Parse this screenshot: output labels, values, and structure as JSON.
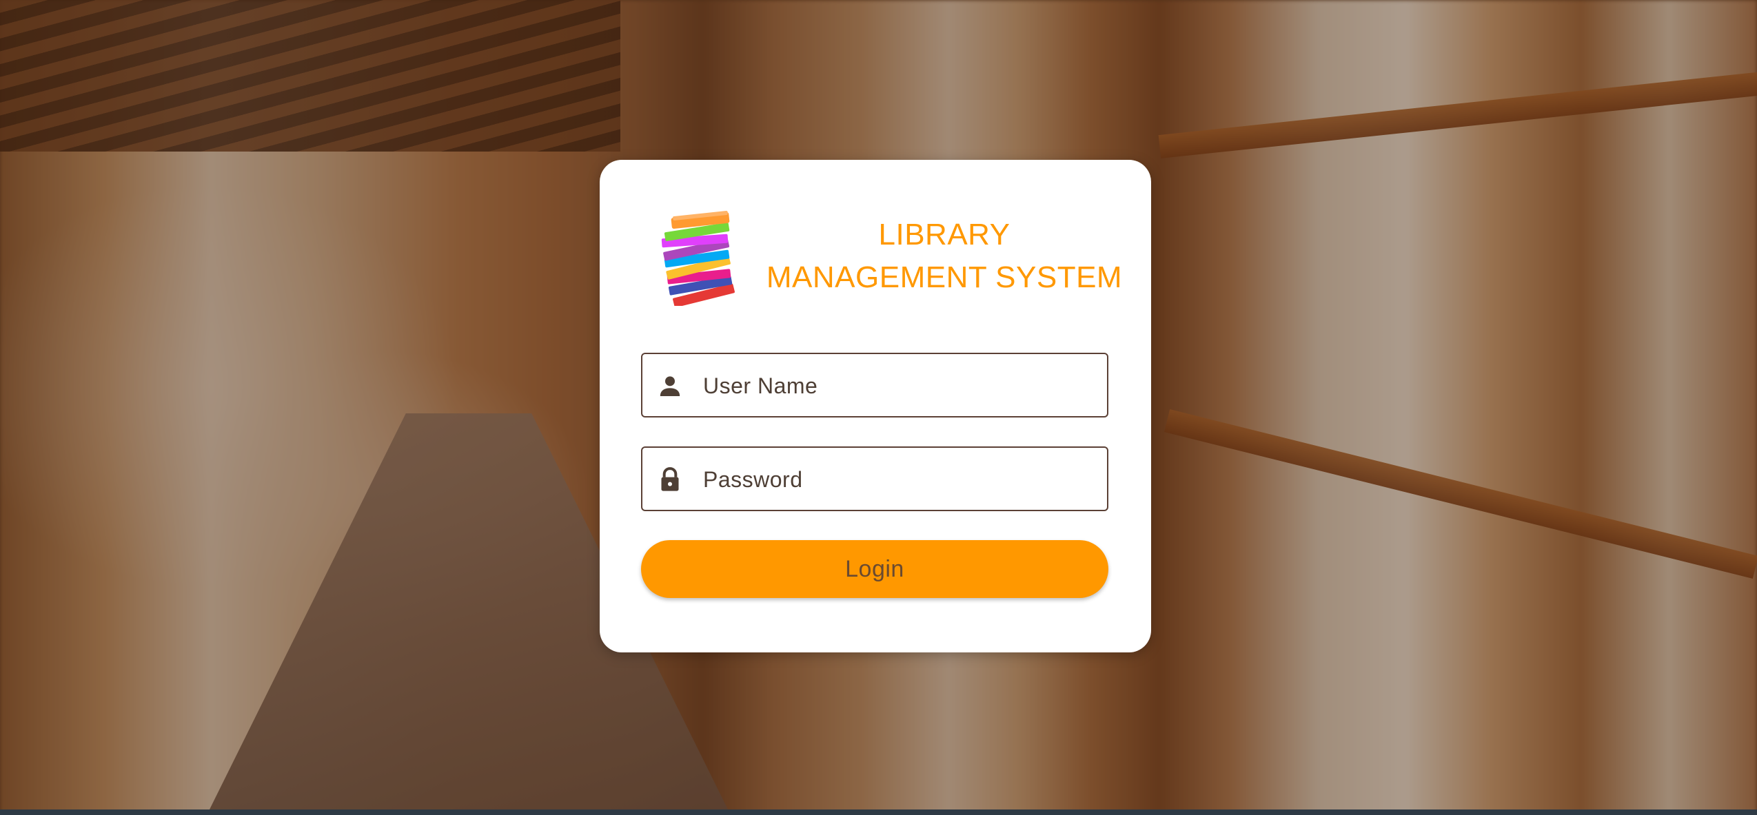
{
  "app": {
    "title_line1": "LIBRARY",
    "title_line2": "MANAGEMENT SYSTEM",
    "logo_icon": "book-stack-icon",
    "accent_color": "#ff9800"
  },
  "form": {
    "username": {
      "placeholder": "User Name",
      "value": "",
      "icon": "person-icon"
    },
    "password": {
      "placeholder": "Password",
      "value": "",
      "icon": "lock-icon"
    },
    "login_label": "Login"
  },
  "background": {
    "description_icon": "library-bookshelves-image"
  }
}
